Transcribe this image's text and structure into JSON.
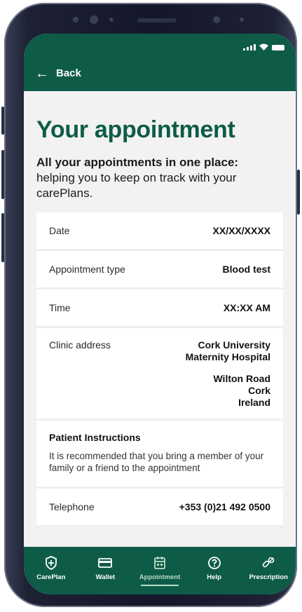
{
  "header": {
    "back_label": "Back"
  },
  "page": {
    "title": "Your appointment",
    "intro_bold": "All your appointments in one place:",
    "intro_text": "helping you to keep on track with your carePlans."
  },
  "details": {
    "date_label": "Date",
    "date_value": "XX/XX/XXXX",
    "type_label": "Appointment type",
    "type_value": "Blood test",
    "time_label": "Time",
    "time_value": "XX:XX AM",
    "address_label": "Clinic address",
    "address_lines_1": [
      "Cork University",
      "Maternity Hospital"
    ],
    "address_lines_2": [
      "Wilton Road",
      "Cork",
      "Ireland"
    ],
    "instructions_title": "Patient Instructions",
    "instructions_text": "It is recommended that you bring a member of your family or a friend to the appointment",
    "telephone_label": "Telephone",
    "telephone_value": "+353 (0)21 492 0500"
  },
  "nav": {
    "items": [
      {
        "label": "CarePlan",
        "icon": "shield-plus-icon"
      },
      {
        "label": "Wallet",
        "icon": "card-icon"
      },
      {
        "label": "Appointment",
        "icon": "calendar-icon"
      },
      {
        "label": "Help",
        "icon": "help-icon"
      },
      {
        "label": "Prescription",
        "icon": "pills-icon"
      }
    ],
    "active": "Appointment"
  },
  "colors": {
    "brand_green": "#0e5c47",
    "active_tab": "#b9dcc8",
    "background": "#f2f2f2"
  }
}
